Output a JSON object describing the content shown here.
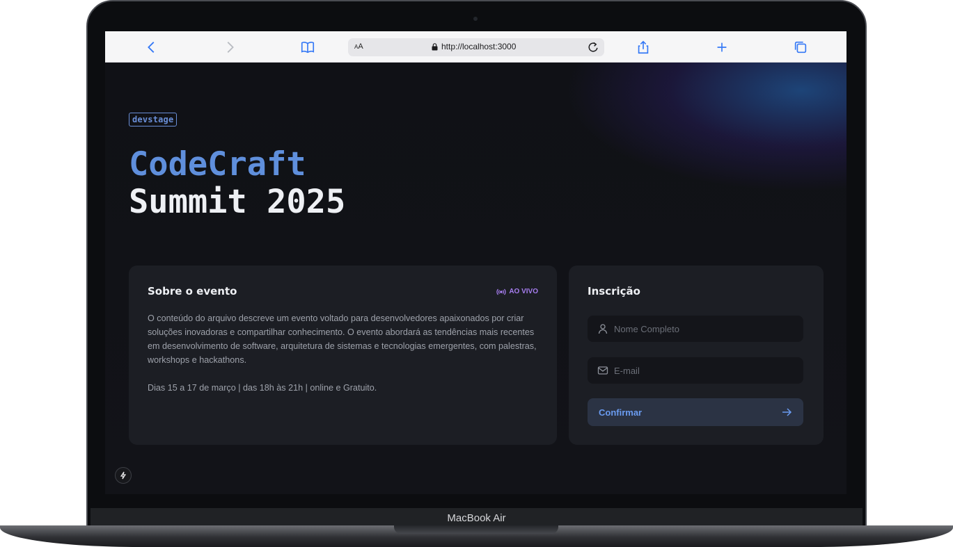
{
  "device": {
    "label": "MacBook Air"
  },
  "browser": {
    "aa_label": "AA",
    "url": "http://localhost:3000"
  },
  "page": {
    "logo": "devstage",
    "title_line1": "CodeCraft",
    "title_line2": "Summit 2025",
    "about": {
      "heading": "Sobre o evento",
      "live_badge": "AO VIVO",
      "description": "O conteúdo do arquivo descreve um evento voltado para desenvolvedores apaixonados por criar soluções inovadoras e compartilhar conhecimento. O evento abordará as tendências mais recentes em desenvolvimento de software, arquitetura de sistemas e tecnologias emergentes, com palestras, workshops e hackathons.",
      "dates": "Dias 15 a 17 de março | das 18h às 21h | online e Gratuito."
    },
    "registration": {
      "heading": "Inscrição",
      "name_placeholder": "Nome Completo",
      "email_placeholder": "E-mail",
      "confirm_label": "Confirmar"
    }
  },
  "colors": {
    "accent_blue": "#5f8fdc",
    "live_purple": "#a77ef0",
    "card_bg": "#1c1e24",
    "page_bg": "#121318"
  },
  "icons": [
    "back-icon",
    "forward-icon",
    "bookmarks-icon",
    "lock-icon",
    "reload-icon",
    "share-icon",
    "new-tab-icon",
    "tabs-icon",
    "live-broadcast-icon",
    "user-icon",
    "mail-icon",
    "arrow-right-icon",
    "lightning-icon"
  ]
}
